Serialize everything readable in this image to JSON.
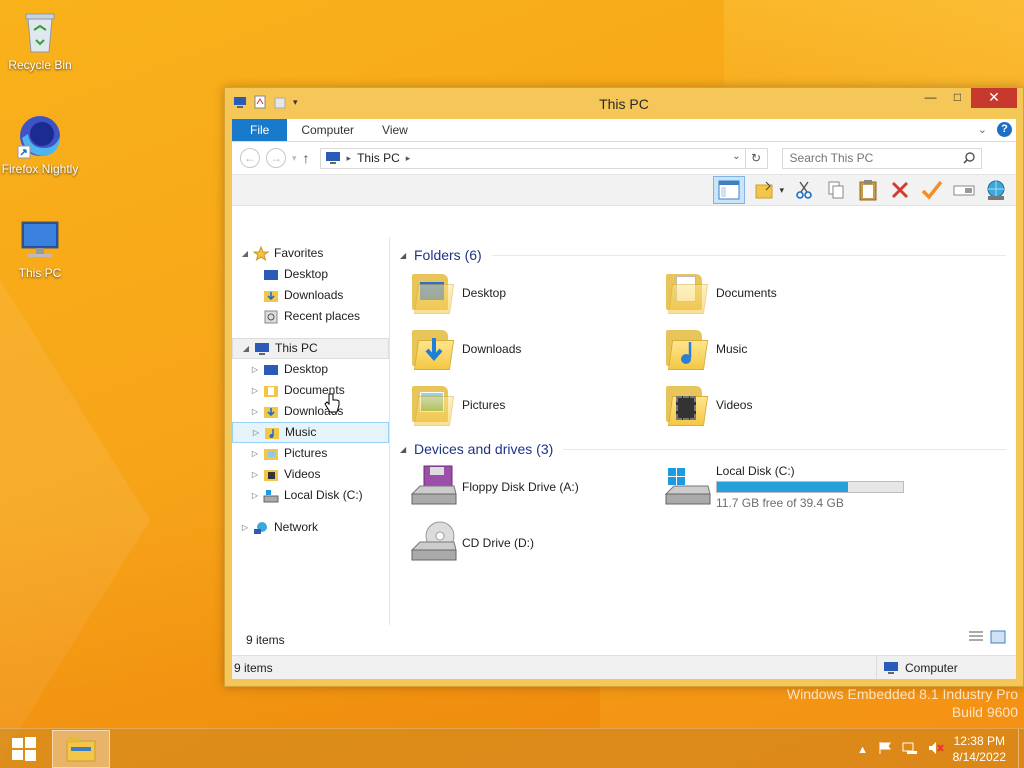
{
  "desktop": {
    "icons": [
      {
        "label": "Recycle Bin"
      },
      {
        "label": "Firefox Nightly"
      },
      {
        "label": "This PC"
      }
    ],
    "watermark_line1": "Windows Embedded 8.1 Industry Pro",
    "watermark_line2": "Build 9600"
  },
  "window": {
    "title": "This PC",
    "ribbon_tabs": [
      "File",
      "Computer",
      "View"
    ],
    "address": {
      "location": "This PC"
    },
    "search": {
      "placeholder": "Search This PC"
    },
    "nav": {
      "favorites": "Favorites",
      "fav_items": [
        "Desktop",
        "Downloads",
        "Recent places"
      ],
      "this_pc": "This PC",
      "pc_items": [
        "Desktop",
        "Documents",
        "Downloads",
        "Music",
        "Pictures",
        "Videos",
        "Local Disk (C:)"
      ],
      "network": "Network"
    },
    "folders_header": "Folders (6)",
    "folders": [
      "Desktop",
      "Documents",
      "Downloads",
      "Music",
      "Pictures",
      "Videos"
    ],
    "devices_header": "Devices and drives (3)",
    "drives": {
      "floppy": "Floppy Disk Drive (A:)",
      "local": "Local Disk (C:)",
      "local_free": "11.7 GB free of 39.4 GB",
      "local_used_fraction": 0.703,
      "cd": "CD Drive (D:)"
    },
    "item_count": "9 items",
    "status_left": "9 items",
    "status_right": "Computer"
  },
  "taskbar": {
    "time": "12:38 PM",
    "date": "8/14/2022"
  },
  "colors": {
    "accent": "#1979ca",
    "drive_bar": "#26a0da",
    "close": "#c7392d"
  }
}
